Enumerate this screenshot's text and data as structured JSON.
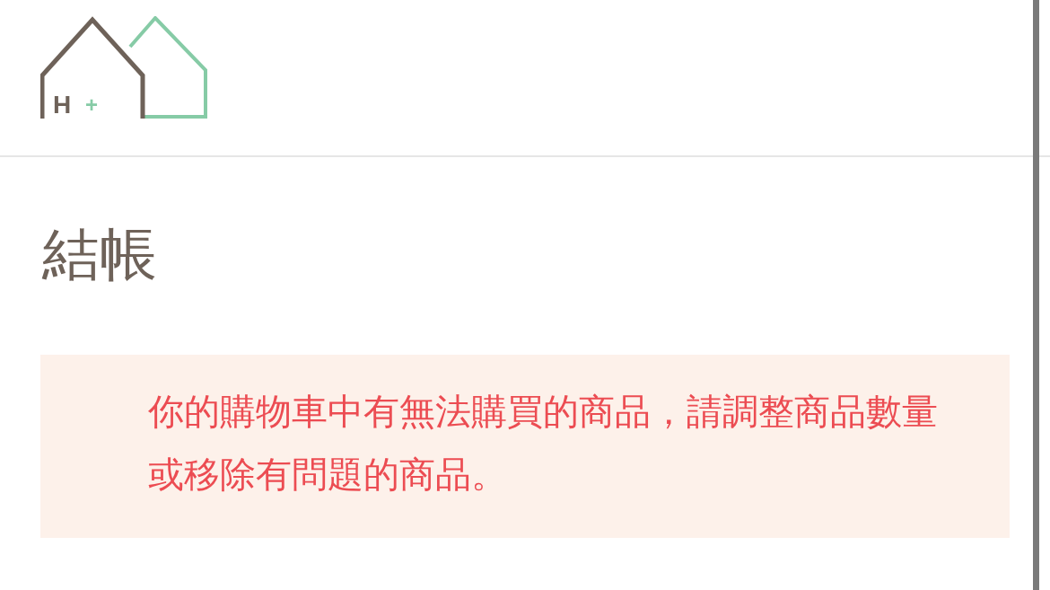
{
  "logo": {
    "letter": "H",
    "mark": "+"
  },
  "page_title": "結帳",
  "alert": {
    "message": "你的購物車中有無法購買的商品，請調整商品數量或移除有問題的商品。"
  }
}
